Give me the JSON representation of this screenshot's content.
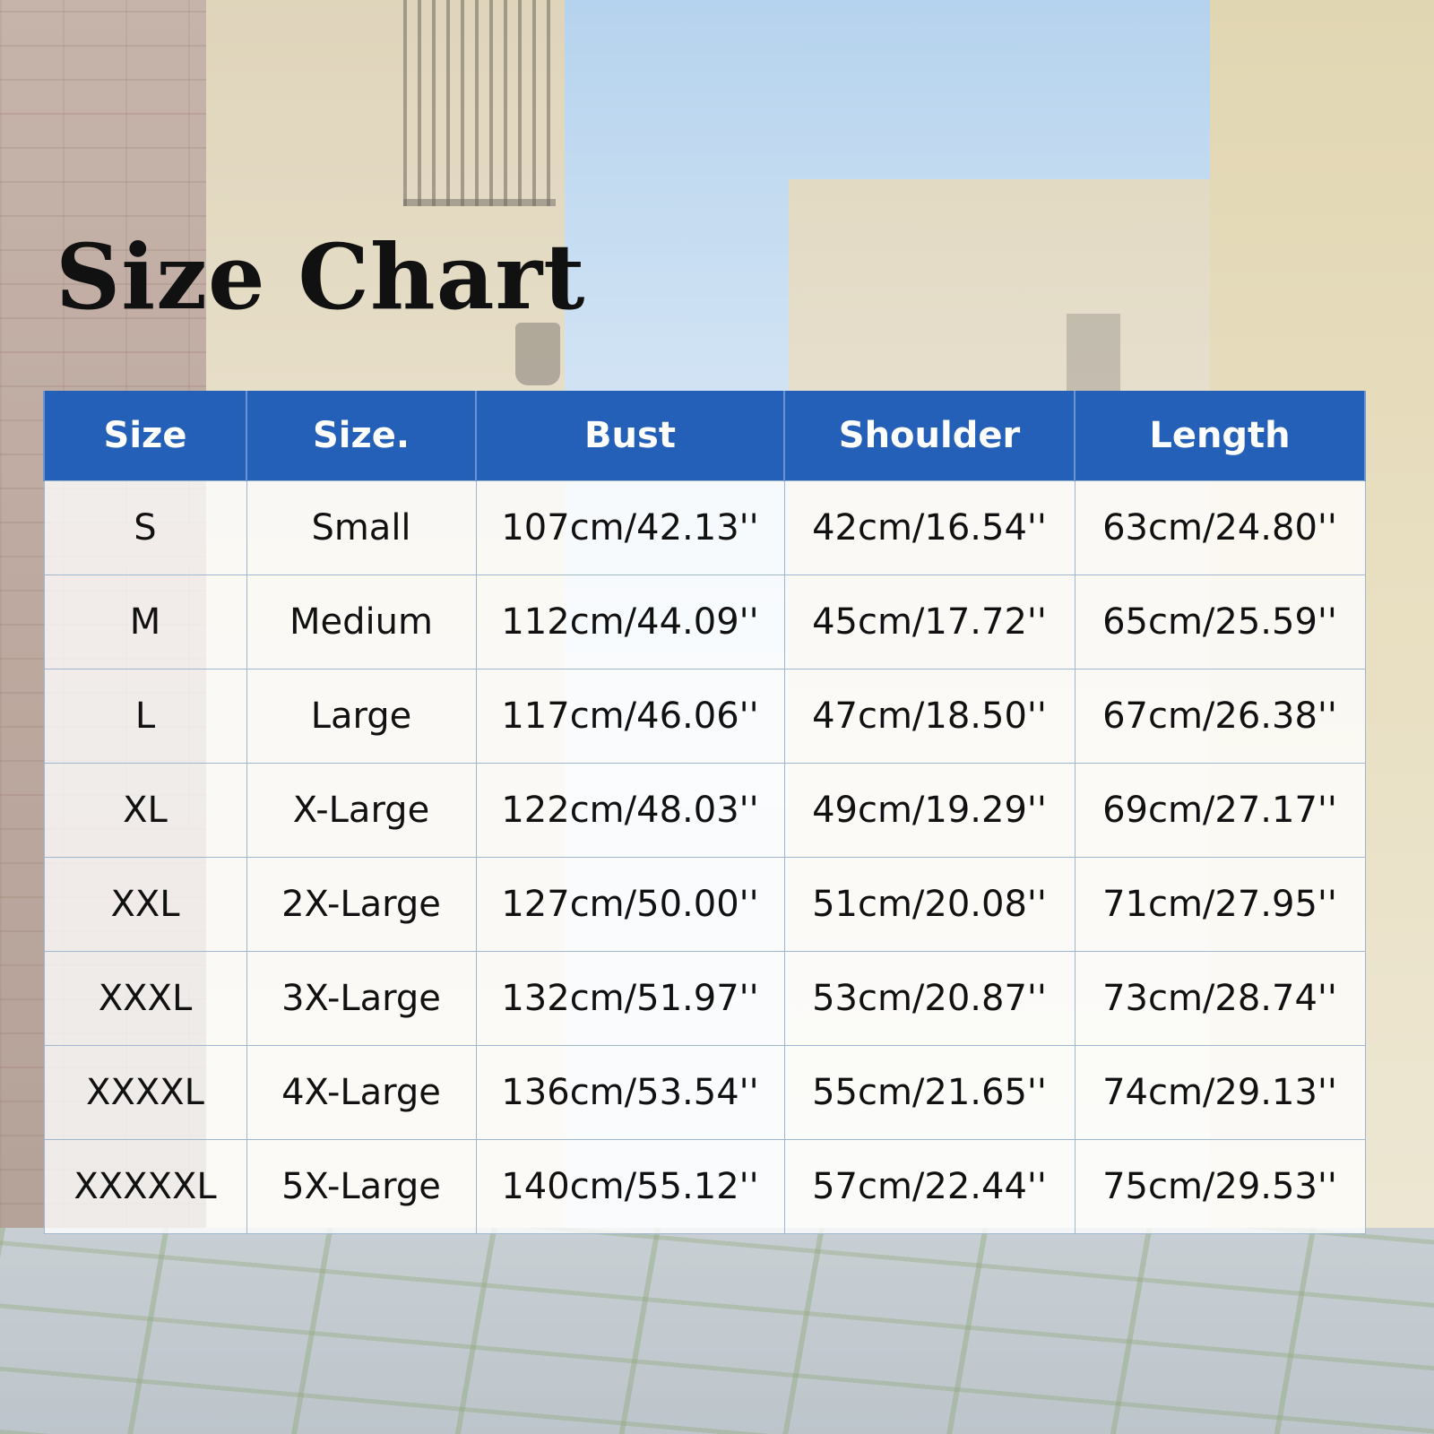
{
  "title": "Size Chart",
  "table": {
    "headers": [
      "Size",
      "Size.",
      "Bust",
      "Shoulder",
      "Length"
    ],
    "rows": [
      [
        "S",
        "Small",
        "107cm/42.13''",
        "42cm/16.54''",
        "63cm/24.80''"
      ],
      [
        "M",
        "Medium",
        "112cm/44.09''",
        "45cm/17.72''",
        "65cm/25.59''"
      ],
      [
        "L",
        "Large",
        "117cm/46.06''",
        "47cm/18.50''",
        "67cm/26.38''"
      ],
      [
        "XL",
        "X-Large",
        "122cm/48.03''",
        "49cm/19.29''",
        "69cm/27.17''"
      ],
      [
        "XXL",
        "2X-Large",
        "127cm/50.00''",
        "51cm/20.08''",
        "71cm/27.95''"
      ],
      [
        "XXXL",
        "3X-Large",
        "132cm/51.97''",
        "53cm/20.87''",
        "73cm/28.74''"
      ],
      [
        "XXXXL",
        "4X-Large",
        "136cm/53.54''",
        "55cm/21.65''",
        "74cm/29.13''"
      ],
      [
        "XXXXXL",
        "5X-Large",
        "140cm/55.12''",
        "57cm/22.44''",
        "75cm/29.53''"
      ]
    ]
  },
  "colors": {
    "header_background": "#2560b8",
    "header_text": "#ffffff",
    "cell_text": "#111111",
    "grid_line": "#9fb6cf"
  }
}
